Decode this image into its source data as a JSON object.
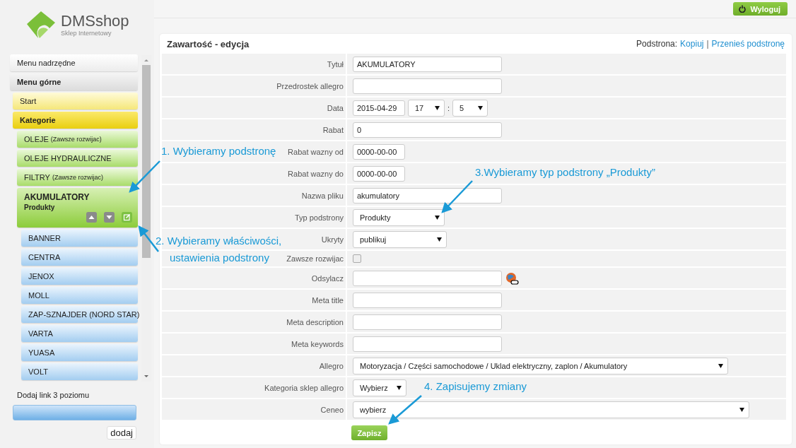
{
  "logo": {
    "name": "DMSshop",
    "tagline": "Sklep Internetowy"
  },
  "sidebar": {
    "items": [
      {
        "label": "Menu nadrzędne",
        "selected": false
      },
      {
        "label": "Menu górne",
        "selected": true,
        "children": [
          {
            "label": "Start",
            "selected": false
          },
          {
            "label": "Kategorie",
            "selected": true,
            "children": [
              {
                "label": "OLEJE",
                "note": "(Zawsze rozwijac)",
                "selected": false
              },
              {
                "label": "OLEJE HYDRAULICZNE",
                "selected": false
              },
              {
                "label": "FILTRY",
                "note": "(Zawsze rozwijac)",
                "selected": false
              },
              {
                "label": "AKUMULATORY",
                "subtitle": "Produkty",
                "selected": true,
                "children": [
                  {
                    "label": "BANNER",
                    "selected": false
                  },
                  {
                    "label": "CENTRA",
                    "selected": false
                  },
                  {
                    "label": "JENOX",
                    "selected": false
                  },
                  {
                    "label": "MOLL",
                    "selected": false
                  },
                  {
                    "label": "ZAP-SZNAJDER (NORD STAR)",
                    "selected": false
                  },
                  {
                    "label": "VARTA",
                    "selected": false
                  },
                  {
                    "label": "YUASA",
                    "selected": false
                  },
                  {
                    "label": "VOLT",
                    "selected": false
                  }
                ]
              }
            ]
          }
        ]
      }
    ],
    "add_label": "Dodaj link 3 poziomu",
    "add_button": "dodaj"
  },
  "topbar": {
    "logout": "Wyloguj"
  },
  "card": {
    "title": "Zawartość - edycja",
    "subpage_label": "Podstrona:",
    "links": [
      "Kopiuj",
      "Przenieś podstronę"
    ],
    "separator": "|",
    "rows": [
      {
        "label": "Tytuł",
        "kind": "text",
        "value": "AKUMULATORY"
      },
      {
        "label": "Przedrostek allegro",
        "kind": "text"
      },
      {
        "label": "Data",
        "kind": "datetime",
        "value": "2015-04-29",
        "hour": "17",
        "separator": ":",
        "minute": "5"
      },
      {
        "label": "Rabat",
        "kind": "text",
        "value": "0"
      },
      {
        "label": "Rabat wazny od",
        "kind": "short",
        "value": "0000-00-00"
      },
      {
        "label": "Rabat wazny do",
        "kind": "short",
        "value": "0000-00-00"
      },
      {
        "label": "Nazwa pliku",
        "kind": "text",
        "value": "akumulatory"
      },
      {
        "label": "Typ podstrony",
        "kind": "select",
        "value": "Produkty"
      },
      {
        "label": "Ukryty",
        "kind": "select",
        "value": "publikuj"
      },
      {
        "label": "Zawsze rozwijac",
        "kind": "checkbox",
        "checked": false
      },
      {
        "label": "Odsylacz",
        "kind": "link",
        "value": ""
      },
      {
        "label": "Meta title",
        "kind": "text"
      },
      {
        "label": "Meta description",
        "kind": "text"
      },
      {
        "label": "Meta keywords",
        "kind": "text"
      },
      {
        "label": "Allegro",
        "kind": "select",
        "value": "Motoryzacja / Części samochodowe / Uklad elektryczny, zaplon / Akumulatory"
      },
      {
        "label": "Kategoria sklep allegro",
        "kind": "select",
        "value": "Wybierz"
      },
      {
        "label": "Ceneo",
        "kind": "select",
        "value": "wybierz"
      }
    ],
    "save": "Zapisz"
  },
  "annotations": [
    {
      "lines": [
        "1. Wybieramy podstronę"
      ]
    },
    {
      "lines": [
        "2. Wybieramy właściwości,",
        "ustawienia podstrony"
      ]
    },
    {
      "lines": [
        "3.Wybieramy typ podstrony „Produkty”"
      ]
    },
    {
      "lines": [
        "4. Zapisujemy zmiany"
      ]
    }
  ]
}
